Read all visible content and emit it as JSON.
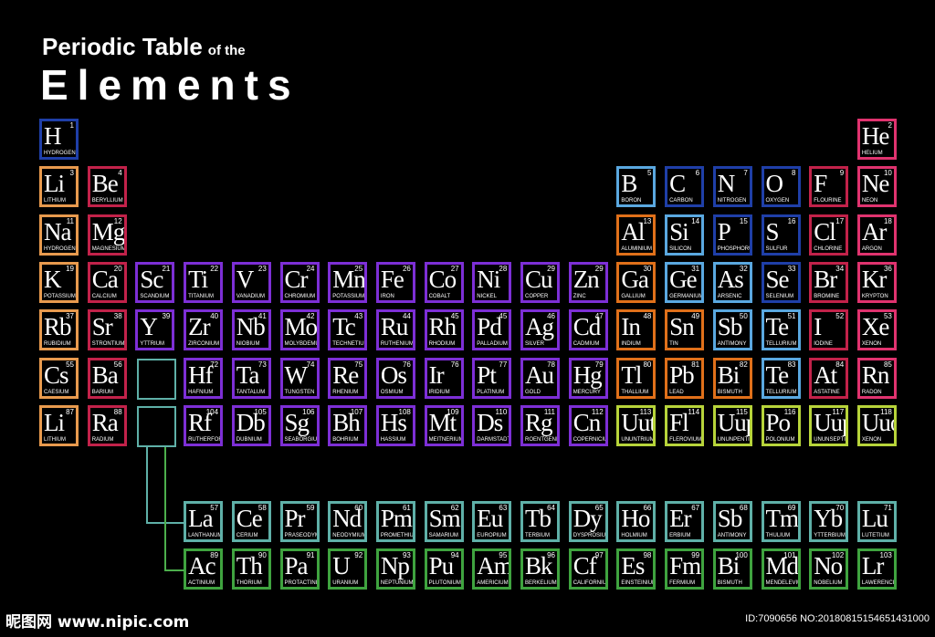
{
  "title": {
    "line1": "Periodic Table",
    "of_the": "of the",
    "line2": "Elements"
  },
  "colors": {
    "blue": "#1f3fa8",
    "pink": "#e0336f",
    "orange": "#e89a4e",
    "crimson": "#c2224a",
    "purple": "#7d2fd6",
    "skyblue": "#5aa8e0",
    "tangerine": "#e0701a",
    "lime": "#b7d43a",
    "teal": "#5fb0a8",
    "green": "#3fa33f"
  },
  "elements": [
    {
      "s": "H",
      "n": "1",
      "name": "HYDROGEN",
      "c": "blue",
      "r": 0,
      "col": 0
    },
    {
      "s": "He",
      "n": "2",
      "name": "HELIUM",
      "c": "pink",
      "r": 0,
      "col": 17
    },
    {
      "s": "Li",
      "n": "3",
      "name": "LITHIUM",
      "c": "orange",
      "r": 1,
      "col": 0
    },
    {
      "s": "Be",
      "n": "4",
      "name": "BERYLLIUM",
      "c": "crimson",
      "r": 1,
      "col": 1
    },
    {
      "s": "B",
      "n": "5",
      "name": "BORON",
      "c": "skyblue",
      "r": 1,
      "col": 12
    },
    {
      "s": "C",
      "n": "6",
      "name": "CARBON",
      "c": "blue",
      "r": 1,
      "col": 13
    },
    {
      "s": "N",
      "n": "7",
      "name": "NITROGEN",
      "c": "blue",
      "r": 1,
      "col": 14
    },
    {
      "s": "O",
      "n": "8",
      "name": "OXYGEN",
      "c": "blue",
      "r": 1,
      "col": 15
    },
    {
      "s": "F",
      "n": "9",
      "name": "FLOURINE",
      "c": "crimson",
      "r": 1,
      "col": 16
    },
    {
      "s": "Ne",
      "n": "10",
      "name": "NEON",
      "c": "pink",
      "r": 1,
      "col": 17
    },
    {
      "s": "Na",
      "n": "11",
      "name": "HYDROGEN",
      "c": "orange",
      "r": 2,
      "col": 0
    },
    {
      "s": "Mg",
      "n": "12",
      "name": "MAGNESIUM",
      "c": "crimson",
      "r": 2,
      "col": 1
    },
    {
      "s": "Al",
      "n": "13",
      "name": "ALUMINIUM",
      "c": "tangerine",
      "r": 2,
      "col": 12
    },
    {
      "s": "Si",
      "n": "14",
      "name": "SILICON",
      "c": "skyblue",
      "r": 2,
      "col": 13
    },
    {
      "s": "P",
      "n": "15",
      "name": "PHOSPHORUS",
      "c": "blue",
      "r": 2,
      "col": 14
    },
    {
      "s": "S",
      "n": "16",
      "name": "SULFUR",
      "c": "blue",
      "r": 2,
      "col": 15
    },
    {
      "s": "Cl",
      "n": "17",
      "name": "CHLORINE",
      "c": "crimson",
      "r": 2,
      "col": 16
    },
    {
      "s": "Ar",
      "n": "18",
      "name": "ARGON",
      "c": "pink",
      "r": 2,
      "col": 17
    },
    {
      "s": "K",
      "n": "19",
      "name": "POTASSIUM",
      "c": "orange",
      "r": 3,
      "col": 0
    },
    {
      "s": "Ca",
      "n": "20",
      "name": "CALCIUM",
      "c": "crimson",
      "r": 3,
      "col": 1
    },
    {
      "s": "Sc",
      "n": "21",
      "name": "SCANDIUM",
      "c": "purple",
      "r": 3,
      "col": 2
    },
    {
      "s": "Ti",
      "n": "22",
      "name": "TITANIUM",
      "c": "purple",
      "r": 3,
      "col": 3
    },
    {
      "s": "V",
      "n": "23",
      "name": "VANADIUM",
      "c": "purple",
      "r": 3,
      "col": 4
    },
    {
      "s": "Cr",
      "n": "24",
      "name": "CHROMIUM",
      "c": "purple",
      "r": 3,
      "col": 5
    },
    {
      "s": "Mn",
      "n": "25",
      "name": "POTASSIUM",
      "c": "purple",
      "r": 3,
      "col": 6
    },
    {
      "s": "Fe",
      "n": "26",
      "name": "IRON",
      "c": "purple",
      "r": 3,
      "col": 7
    },
    {
      "s": "Co",
      "n": "27",
      "name": "COBALT",
      "c": "purple",
      "r": 3,
      "col": 8
    },
    {
      "s": "Ni",
      "n": "28",
      "name": "NICKEL",
      "c": "purple",
      "r": 3,
      "col": 9
    },
    {
      "s": "Cu",
      "n": "29",
      "name": "COPPER",
      "c": "purple",
      "r": 3,
      "col": 10
    },
    {
      "s": "Zn",
      "n": "29",
      "name": "ZINC",
      "c": "purple",
      "r": 3,
      "col": 11
    },
    {
      "s": "Ga",
      "n": "30",
      "name": "GALLIUM",
      "c": "tangerine",
      "r": 3,
      "col": 12
    },
    {
      "s": "Ge",
      "n": "31",
      "name": "GERMANIUM",
      "c": "skyblue",
      "r": 3,
      "col": 13
    },
    {
      "s": "As",
      "n": "32",
      "name": "ARSENIC",
      "c": "skyblue",
      "r": 3,
      "col": 14
    },
    {
      "s": "Se",
      "n": "33",
      "name": "SELENIUM",
      "c": "blue",
      "r": 3,
      "col": 15
    },
    {
      "s": "Br",
      "n": "34",
      "name": "BROMINE",
      "c": "crimson",
      "r": 3,
      "col": 16
    },
    {
      "s": "Kr",
      "n": "36",
      "name": "KRYPTON",
      "c": "pink",
      "r": 3,
      "col": 17
    },
    {
      "s": "Rb",
      "n": "37",
      "name": "RUBIDIUM",
      "c": "orange",
      "r": 4,
      "col": 0
    },
    {
      "s": "Sr",
      "n": "38",
      "name": "STRONTIUM",
      "c": "crimson",
      "r": 4,
      "col": 1
    },
    {
      "s": "Y",
      "n": "39",
      "name": "YTTRIUM",
      "c": "purple",
      "r": 4,
      "col": 2
    },
    {
      "s": "Zr",
      "n": "40",
      "name": "ZIRCONIUM",
      "c": "purple",
      "r": 4,
      "col": 3
    },
    {
      "s": "Nb",
      "n": "41",
      "name": "NIOBIUM",
      "c": "purple",
      "r": 4,
      "col": 4
    },
    {
      "s": "Mo",
      "n": "42",
      "name": "MOLYBDEMUM",
      "c": "purple",
      "r": 4,
      "col": 5
    },
    {
      "s": "Tc",
      "n": "43",
      "name": "TECHNETIUM",
      "c": "purple",
      "r": 4,
      "col": 6
    },
    {
      "s": "Ru",
      "n": "44",
      "name": "RUTHENIUM",
      "c": "purple",
      "r": 4,
      "col": 7
    },
    {
      "s": "Rh",
      "n": "45",
      "name": "RHODIUM",
      "c": "purple",
      "r": 4,
      "col": 8
    },
    {
      "s": "Pd",
      "n": "45",
      "name": "PALLADIUM",
      "c": "purple",
      "r": 4,
      "col": 9
    },
    {
      "s": "Ag",
      "n": "46",
      "name": "SILVER",
      "c": "purple",
      "r": 4,
      "col": 10
    },
    {
      "s": "Cd",
      "n": "47",
      "name": "CADMIUM",
      "c": "purple",
      "r": 4,
      "col": 11
    },
    {
      "s": "In",
      "n": "48",
      "name": "INDIUM",
      "c": "tangerine",
      "r": 4,
      "col": 12
    },
    {
      "s": "Sn",
      "n": "49",
      "name": "TIN",
      "c": "tangerine",
      "r": 4,
      "col": 13
    },
    {
      "s": "Sb",
      "n": "50",
      "name": "ANTIMONY",
      "c": "skyblue",
      "r": 4,
      "col": 14
    },
    {
      "s": "Te",
      "n": "51",
      "name": "TELLURIUM",
      "c": "skyblue",
      "r": 4,
      "col": 15
    },
    {
      "s": "I",
      "n": "52",
      "name": "IODINE",
      "c": "crimson",
      "r": 4,
      "col": 16
    },
    {
      "s": "Xe",
      "n": "53",
      "name": "XENON",
      "c": "pink",
      "r": 4,
      "col": 17
    },
    {
      "s": "Cs",
      "n": "55",
      "name": "CAESIUM",
      "c": "orange",
      "r": 5,
      "col": 0
    },
    {
      "s": "Ba",
      "n": "56",
      "name": "BARIUM",
      "c": "crimson",
      "r": 5,
      "col": 1
    },
    {
      "s": "Hf",
      "n": "72",
      "name": "HAFNIUM",
      "c": "purple",
      "r": 5,
      "col": 3
    },
    {
      "s": "Ta",
      "n": "73",
      "name": "TANTALUM",
      "c": "purple",
      "r": 5,
      "col": 4
    },
    {
      "s": "W",
      "n": "74",
      "name": "TUNGSTEN",
      "c": "purple",
      "r": 5,
      "col": 5
    },
    {
      "s": "Re",
      "n": "75",
      "name": "RHENIUM",
      "c": "purple",
      "r": 5,
      "col": 6
    },
    {
      "s": "Os",
      "n": "76",
      "name": "OSMIUM",
      "c": "purple",
      "r": 5,
      "col": 7
    },
    {
      "s": "Ir",
      "n": "76",
      "name": "IRIDIUM",
      "c": "purple",
      "r": 5,
      "col": 8
    },
    {
      "s": "Pt",
      "n": "77",
      "name": "PLATINUM",
      "c": "purple",
      "r": 5,
      "col": 9
    },
    {
      "s": "Au",
      "n": "78",
      "name": "GOLD",
      "c": "purple",
      "r": 5,
      "col": 10
    },
    {
      "s": "Hg",
      "n": "79",
      "name": "MERCURY",
      "c": "purple",
      "r": 5,
      "col": 11
    },
    {
      "s": "Tl",
      "n": "80",
      "name": "THALLIUM",
      "c": "tangerine",
      "r": 5,
      "col": 12
    },
    {
      "s": "Pb",
      "n": "81",
      "name": "LEAD",
      "c": "tangerine",
      "r": 5,
      "col": 13
    },
    {
      "s": "Bi",
      "n": "82",
      "name": "BISMUTH",
      "c": "tangerine",
      "r": 5,
      "col": 14
    },
    {
      "s": "Te",
      "n": "83",
      "name": "TELLURIUM",
      "c": "skyblue",
      "r": 5,
      "col": 15
    },
    {
      "s": "At",
      "n": "84",
      "name": "ASTATINE",
      "c": "crimson",
      "r": 5,
      "col": 16
    },
    {
      "s": "Rn",
      "n": "85",
      "name": "RADON",
      "c": "pink",
      "r": 5,
      "col": 17
    },
    {
      "s": "Li",
      "n": "87",
      "name": "LITHIUM",
      "c": "orange",
      "r": 6,
      "col": 0
    },
    {
      "s": "Ra",
      "n": "88",
      "name": "RADIUM",
      "c": "crimson",
      "r": 6,
      "col": 1
    },
    {
      "s": "Rf",
      "n": "104",
      "name": "RUTHERFORDIUM",
      "c": "purple",
      "r": 6,
      "col": 3
    },
    {
      "s": "Db",
      "n": "105",
      "name": "DUBNIUM",
      "c": "purple",
      "r": 6,
      "col": 4
    },
    {
      "s": "Sg",
      "n": "106",
      "name": "SEABORGIUM",
      "c": "purple",
      "r": 6,
      "col": 5
    },
    {
      "s": "Bh",
      "n": "107",
      "name": "BOHRIUM",
      "c": "purple",
      "r": 6,
      "col": 6
    },
    {
      "s": "Hs",
      "n": "108",
      "name": "HASSIUM",
      "c": "purple",
      "r": 6,
      "col": 7
    },
    {
      "s": "Mt",
      "n": "109",
      "name": "MEITNERIUM",
      "c": "purple",
      "r": 6,
      "col": 8
    },
    {
      "s": "Ds",
      "n": "110",
      "name": "DARMSTADTIUM",
      "c": "purple",
      "r": 6,
      "col": 9
    },
    {
      "s": "Rg",
      "n": "111",
      "name": "ROENTGENIUM",
      "c": "purple",
      "r": 6,
      "col": 10
    },
    {
      "s": "Cn",
      "n": "112",
      "name": "COPERNICIUM",
      "c": "purple",
      "r": 6,
      "col": 11
    },
    {
      "s": "Uut",
      "n": "113",
      "name": "UNUNTRIUM",
      "c": "lime",
      "r": 6,
      "col": 12
    },
    {
      "s": "Fl",
      "n": "114",
      "name": "FLEROVIUM",
      "c": "lime",
      "r": 6,
      "col": 13
    },
    {
      "s": "Uup",
      "n": "115",
      "name": "UNUNPENTIUM",
      "c": "lime",
      "r": 6,
      "col": 14
    },
    {
      "s": "Po",
      "n": "116",
      "name": "POLONIUM",
      "c": "lime",
      "r": 6,
      "col": 15
    },
    {
      "s": "Uup",
      "n": "117",
      "name": "UNUNSEPTIUM",
      "c": "lime",
      "r": 6,
      "col": 16
    },
    {
      "s": "Uuo",
      "n": "118",
      "name": "XENON",
      "c": "lime",
      "r": 6,
      "col": 17
    },
    {
      "s": "La",
      "n": "57",
      "name": "LANTHANUM",
      "c": "teal",
      "r": 8,
      "col": 3
    },
    {
      "s": "Ce",
      "n": "58",
      "name": "CERIUM",
      "c": "teal",
      "r": 8,
      "col": 4
    },
    {
      "s": "Pr",
      "n": "59",
      "name": "PRASEODYMIUM",
      "c": "teal",
      "r": 8,
      "col": 5
    },
    {
      "s": "Nd",
      "n": "60",
      "name": "NEODYMIUM",
      "c": "teal",
      "r": 8,
      "col": 6
    },
    {
      "s": "Pm",
      "n": "61",
      "name": "PROMETHIUM",
      "c": "teal",
      "r": 8,
      "col": 7
    },
    {
      "s": "Sm",
      "n": "62",
      "name": "SAMARIUM",
      "c": "teal",
      "r": 8,
      "col": 8
    },
    {
      "s": "Eu",
      "n": "63",
      "name": "EUROPIUM",
      "c": "teal",
      "r": 8,
      "col": 9
    },
    {
      "s": "Tb",
      "n": "64",
      "name": "TERBIUM",
      "c": "teal",
      "r": 8,
      "col": 10
    },
    {
      "s": "Dy",
      "n": "65",
      "name": "DYSPROSIUM",
      "c": "teal",
      "r": 8,
      "col": 11
    },
    {
      "s": "Ho",
      "n": "66",
      "name": "HOLMIUM",
      "c": "teal",
      "r": 8,
      "col": 12
    },
    {
      "s": "Er",
      "n": "67",
      "name": "ERBIUM",
      "c": "teal",
      "r": 8,
      "col": 13
    },
    {
      "s": "Sb",
      "n": "68",
      "name": "ANTIMONY",
      "c": "teal",
      "r": 8,
      "col": 14
    },
    {
      "s": "Tm",
      "n": "69",
      "name": "THULIUM",
      "c": "teal",
      "r": 8,
      "col": 15
    },
    {
      "s": "Yb",
      "n": "70",
      "name": "YTTERBIUM",
      "c": "teal",
      "r": 8,
      "col": 16
    },
    {
      "s": "Lu",
      "n": "71",
      "name": "LUTETIUM",
      "c": "teal",
      "r": 8,
      "col": 17
    },
    {
      "s": "Ac",
      "n": "89",
      "name": "ACTINIUM",
      "c": "green",
      "r": 9,
      "col": 3
    },
    {
      "s": "Th",
      "n": "90",
      "name": "THORIUM",
      "c": "green",
      "r": 9,
      "col": 4
    },
    {
      "s": "Pa",
      "n": "91",
      "name": "PROTACTINIUM",
      "c": "green",
      "r": 9,
      "col": 5
    },
    {
      "s": "U",
      "n": "92",
      "name": "URANIUM",
      "c": "green",
      "r": 9,
      "col": 6
    },
    {
      "s": "Np",
      "n": "93",
      "name": "NEPTUNIUM",
      "c": "green",
      "r": 9,
      "col": 7
    },
    {
      "s": "Pu",
      "n": "94",
      "name": "PLUTONIUM",
      "c": "green",
      "r": 9,
      "col": 8
    },
    {
      "s": "Am",
      "n": "95",
      "name": "AMERICIUM",
      "c": "green",
      "r": 9,
      "col": 9
    },
    {
      "s": "Bk",
      "n": "96",
      "name": "BERKELIUM",
      "c": "green",
      "r": 9,
      "col": 10
    },
    {
      "s": "Cf",
      "n": "97",
      "name": "CALIFORNIUM",
      "c": "green",
      "r": 9,
      "col": 11
    },
    {
      "s": "Es",
      "n": "98",
      "name": "EINSTEINIUM",
      "c": "green",
      "r": 9,
      "col": 12
    },
    {
      "s": "Fm",
      "n": "99",
      "name": "FERMIUM",
      "c": "green",
      "r": 9,
      "col": 13
    },
    {
      "s": "Bi",
      "n": "100",
      "name": "BISMUTH",
      "c": "green",
      "r": 9,
      "col": 14
    },
    {
      "s": "Md",
      "n": "101",
      "name": "MENDELEVIUM",
      "c": "green",
      "r": 9,
      "col": 15
    },
    {
      "s": "No",
      "n": "102",
      "name": "NOBELIUM",
      "c": "green",
      "r": 9,
      "col": 16
    },
    {
      "s": "Lr",
      "n": "103",
      "name": "LAWERENCIUM",
      "c": "green",
      "r": 9,
      "col": 17
    }
  ],
  "watermark": {
    "left": "昵图网 www.nipic.com",
    "right": "ID:7090656 NO:20180815154651431000"
  }
}
